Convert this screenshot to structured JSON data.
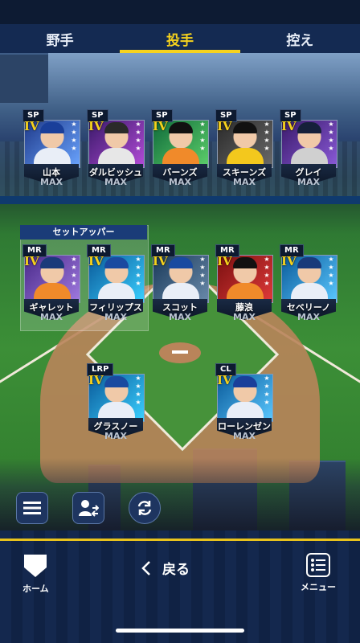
{
  "tabs": [
    {
      "label": "野手",
      "active": false
    },
    {
      "label": "投手",
      "active": true
    },
    {
      "label": "控え",
      "active": false
    }
  ],
  "setup_group_label": "セットアッパー",
  "cards": [
    {
      "pos": "SP",
      "grade": "IV",
      "name": "山本",
      "level": "MAX",
      "colors": [
        "#1f3a8a",
        "#6aa4ff",
        "#1a3f9a",
        "#e9eef7"
      ]
    },
    {
      "pos": "SP",
      "grade": "IV",
      "name": "ダルビッシュ",
      "level": "MAX",
      "colors": [
        "#3a1a6a",
        "#b34bd8",
        "#2a2a2a",
        "#e7e7e7"
      ]
    },
    {
      "pos": "SP",
      "grade": "IV",
      "name": "バーンズ",
      "level": "MAX",
      "colors": [
        "#0f6a3a",
        "#5dd06b",
        "#111111",
        "#f08a2a"
      ]
    },
    {
      "pos": "SP",
      "grade": "IV",
      "name": "スキーンズ",
      "level": "MAX",
      "colors": [
        "#2a2a2a",
        "#6a6a6a",
        "#111111",
        "#f3c81d"
      ]
    },
    {
      "pos": "SP",
      "grade": "IV",
      "name": "グレイ",
      "level": "MAX",
      "colors": [
        "#3a1a6a",
        "#8a5ad8",
        "#15203a",
        "#d0d0d0"
      ]
    },
    {
      "pos": "MR",
      "grade": "IV",
      "name": "ギャレット",
      "level": "MAX",
      "colors": [
        "#4a2a8a",
        "#a07ae0",
        "#1a3a7a",
        "#f08a2a"
      ]
    },
    {
      "pos": "MR",
      "grade": "IV",
      "name": "フィリップス",
      "level": "MAX",
      "colors": [
        "#0a5a9a",
        "#3ad0ff",
        "#1a4aa0",
        "#e9eef7"
      ]
    },
    {
      "pos": "MR",
      "grade": "IV",
      "name": "スコット",
      "level": "MAX",
      "colors": [
        "#1a3a5a",
        "#6a8aaa",
        "#1a4aa0",
        "#e9eef7"
      ]
    },
    {
      "pos": "MR",
      "grade": "IV",
      "name": "藤浪",
      "level": "MAX",
      "colors": [
        "#7a1010",
        "#e03a3a",
        "#111111",
        "#f08a2a"
      ]
    },
    {
      "pos": "MR",
      "grade": "IV",
      "name": "セベリーノ",
      "level": "MAX",
      "colors": [
        "#0a5a9a",
        "#5ac8ff",
        "#1a3a7a",
        "#e9eef7"
      ]
    },
    {
      "pos": "LRP",
      "grade": "IV",
      "name": "グラスノー",
      "level": "MAX",
      "colors": [
        "#0a5a9a",
        "#3ad0ff",
        "#1a4aa0",
        "#e9eef7"
      ]
    },
    {
      "pos": "CL",
      "grade": "IV",
      "name": "ローレンゼン",
      "level": "MAX",
      "colors": [
        "#0a5a9a",
        "#5ac8ff",
        "#1a3f9a",
        "#e9eef7"
      ]
    }
  ],
  "nav": {
    "home_label": "ホーム",
    "back_label": "戻る",
    "menu_label": "メニュー"
  }
}
